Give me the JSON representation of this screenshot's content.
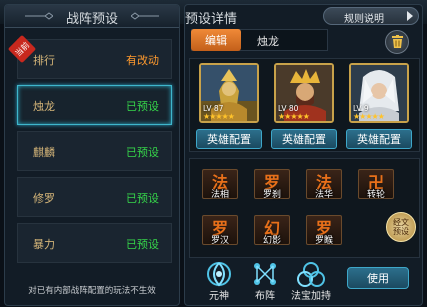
{
  "left_panel": {
    "title": "战阵预设",
    "current_tag": "当前",
    "items": [
      {
        "name": "排行",
        "status": "有改动",
        "status_color": "orange"
      },
      {
        "name": "烛龙",
        "status": "已预设",
        "status_color": "green",
        "selected": true
      },
      {
        "name": "麒麟",
        "status": "已预设",
        "status_color": "green"
      },
      {
        "name": "修罗",
        "status": "已预设",
        "status_color": "green"
      },
      {
        "name": "暴力",
        "status": "已预设",
        "status_color": "green"
      }
    ],
    "footer_note": "对已有内部战阵配置的玩法不生效"
  },
  "right_panel": {
    "title": "预设详情",
    "rules_label": "规则说明",
    "edit_label": "编辑",
    "preset_name": "烛龙",
    "heroes": [
      {
        "level": "LV 87",
        "stars": "★★★★★",
        "portrait": "golden-warrior-portrait",
        "button": "英雄配置"
      },
      {
        "level": "LV 80",
        "stars": "★★★★★",
        "portrait": "crowned-general-portrait",
        "button": "英雄配置"
      },
      {
        "level": "LV 9",
        "stars": "★★★★★",
        "portrait": "white-haired-hero-portrait",
        "button": "英雄配置"
      }
    ],
    "skills_row1": [
      {
        "glyph": "法",
        "label": "法相"
      },
      {
        "glyph": "罗",
        "label": "罗刹"
      },
      {
        "glyph": "法",
        "label": "法华"
      },
      {
        "glyph": "卍",
        "label": "转轮"
      }
    ],
    "skills_row2": [
      {
        "glyph": "罗",
        "label": "罗汉"
      },
      {
        "glyph": "幻",
        "label": "幻影"
      },
      {
        "glyph": "罗",
        "label": "罗睺"
      }
    ],
    "sutra_button": {
      "line1": "经文",
      "line2": "预设"
    },
    "bottom_actions": [
      {
        "label": "元神",
        "icon": "spirit-icon"
      },
      {
        "label": "布阵",
        "icon": "formation-icon"
      },
      {
        "label": "法宝加持",
        "icon": "treasure-icon"
      }
    ],
    "use_label": "使用"
  },
  "colors": {
    "accent_orange": "#f08a38",
    "status_green": "#36d64a",
    "status_orange": "#ff9a2e",
    "selected_border": "#3fb6cc",
    "gold": "#c8a24a"
  }
}
